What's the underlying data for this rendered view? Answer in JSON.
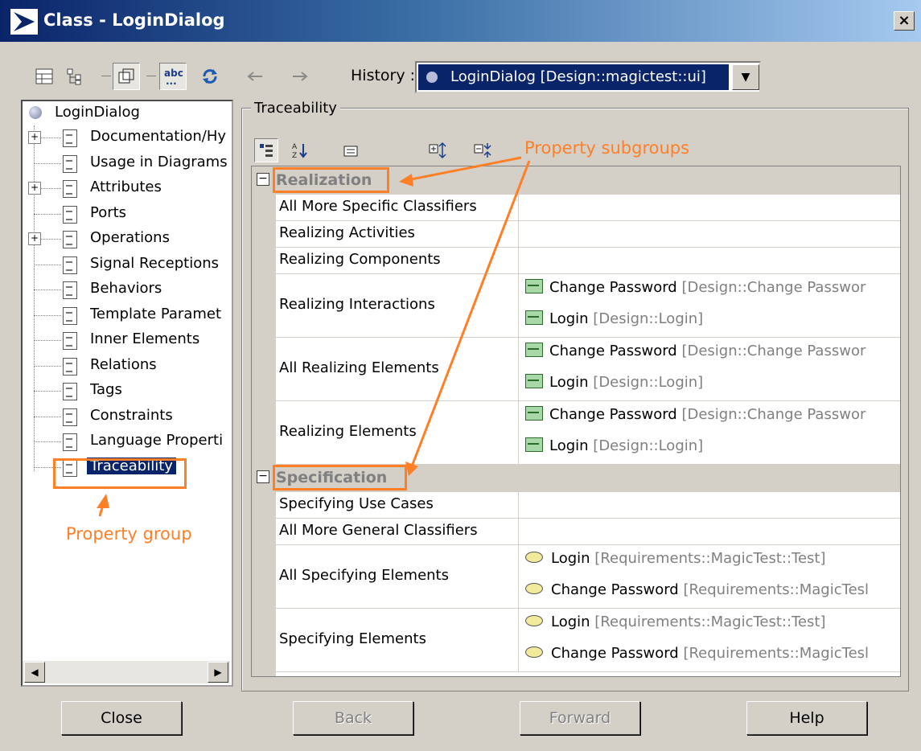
{
  "window": {
    "title": "Class - LoginDialog",
    "close_glyph": "×"
  },
  "toolbar": {
    "history_label": "History :",
    "history_value": "LoginDialog [Design::magictest::ui]",
    "icons": [
      "table-view-icon",
      "tree-view-icon",
      "restore-icon",
      "abc-icon",
      "refresh-icon",
      "back-arrow-icon",
      "forward-arrow-icon"
    ]
  },
  "tree": {
    "root": "LoginDialog",
    "items": [
      {
        "label": "Documentation/Hy",
        "expandable": true
      },
      {
        "label": "Usage in Diagrams",
        "expandable": false
      },
      {
        "label": "Attributes",
        "expandable": true
      },
      {
        "label": "Ports",
        "expandable": false
      },
      {
        "label": "Operations",
        "expandable": true
      },
      {
        "label": "Signal Receptions",
        "expandable": false
      },
      {
        "label": "Behaviors",
        "expandable": false
      },
      {
        "label": "Template Paramet",
        "expandable": false
      },
      {
        "label": "Inner Elements",
        "expandable": false
      },
      {
        "label": "Relations",
        "expandable": false
      },
      {
        "label": "Tags",
        "expandable": false
      },
      {
        "label": "Constraints",
        "expandable": false
      },
      {
        "label": "Language Properti",
        "expandable": false
      },
      {
        "label": "Traceability",
        "expandable": false,
        "selected": true
      }
    ]
  },
  "panel": {
    "title": "Traceability",
    "groups": [
      {
        "name": "Realization",
        "rows": [
          {
            "name": "All More Specific Classifiers",
            "values": []
          },
          {
            "name": "Realizing Activities",
            "values": []
          },
          {
            "name": "Realizing Components",
            "values": []
          },
          {
            "name": "Realizing Interactions",
            "values": [
              {
                "name": "Change Password",
                "qualifier": "[Design::Change Passwor",
                "icon": "interaction-icon"
              },
              {
                "name": "Login",
                "qualifier": "[Design::Login]",
                "icon": "interaction-icon"
              }
            ]
          },
          {
            "name": "All Realizing Elements",
            "values": [
              {
                "name": "Change Password",
                "qualifier": "[Design::Change Passwor",
                "icon": "interaction-icon"
              },
              {
                "name": "Login",
                "qualifier": "[Design::Login]",
                "icon": "interaction-icon"
              }
            ]
          },
          {
            "name": "Realizing Elements",
            "values": [
              {
                "name": "Change Password",
                "qualifier": "[Design::Change Passwor",
                "icon": "interaction-icon"
              },
              {
                "name": "Login",
                "qualifier": "[Design::Login]",
                "icon": "interaction-icon"
              }
            ]
          }
        ]
      },
      {
        "name": "Specification",
        "rows": [
          {
            "name": "Specifying Use Cases",
            "values": []
          },
          {
            "name": "All More General Classifiers",
            "values": []
          },
          {
            "name": "All Specifying Elements",
            "values": [
              {
                "name": "Login",
                "qualifier": "[Requirements::MagicTest::Test]",
                "icon": "use-case-icon"
              },
              {
                "name": "Change Password",
                "qualifier": "[Requirements::MagicTesl",
                "icon": "use-case-icon"
              }
            ]
          },
          {
            "name": "Specifying Elements",
            "values": [
              {
                "name": "Login",
                "qualifier": "[Requirements::MagicTest::Test]",
                "icon": "use-case-icon"
              },
              {
                "name": "Change Password",
                "qualifier": "[Requirements::MagicTesl",
                "icon": "use-case-icon"
              }
            ]
          }
        ]
      }
    ]
  },
  "annotations": {
    "subgroups": "Property subgroups",
    "group": "Property group",
    "color": "#ff7f27"
  },
  "buttons": {
    "close": "Close",
    "back": "Back",
    "forward": "Forward",
    "help": "Help"
  }
}
